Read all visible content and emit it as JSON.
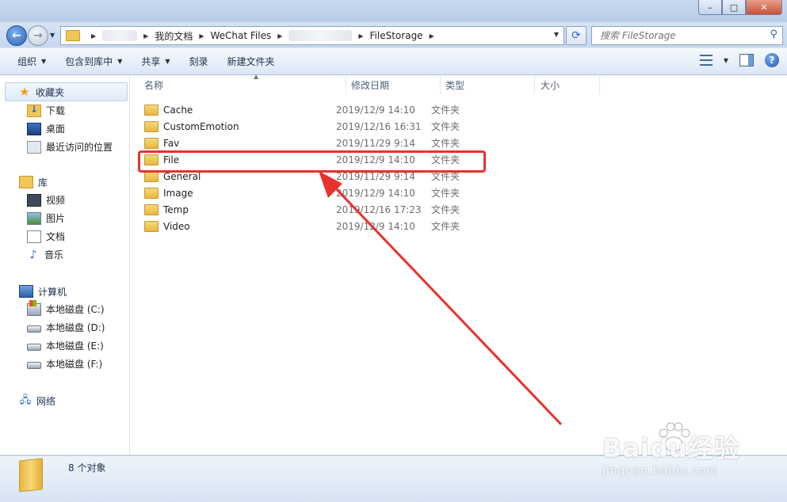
{
  "window": {
    "title_blurred": "",
    "controls": {
      "minimize": "–",
      "maximize": "□",
      "close": "✕"
    }
  },
  "address": {
    "crumbs": [
      "我的文档",
      "WeChat Files",
      "FileStorage"
    ],
    "search_placeholder": "搜索 FileStorage"
  },
  "toolbar": {
    "organize": "组织",
    "include_library": "包含到库中",
    "share": "共享",
    "burn": "刻录",
    "new_folder": "新建文件夹"
  },
  "nav": {
    "favorites": {
      "label": "收藏夹",
      "items": [
        "下载",
        "桌面",
        "最近访问的位置"
      ]
    },
    "libraries": {
      "label": "库",
      "items": [
        "视频",
        "图片",
        "文档",
        "音乐"
      ]
    },
    "computer": {
      "label": "计算机",
      "items": [
        "本地磁盘 (C:)",
        "本地磁盘 (D:)",
        "本地磁盘 (E:)",
        "本地磁盘 (F:)"
      ]
    },
    "network": {
      "label": "网络"
    }
  },
  "columns": {
    "name": "名称",
    "modified": "修改日期",
    "type": "类型",
    "size": "大小"
  },
  "files": [
    {
      "name": "Cache",
      "modified": "2019/12/9 14:10",
      "type": "文件夹"
    },
    {
      "name": "CustomEmotion",
      "modified": "2019/12/16 16:31",
      "type": "文件夹"
    },
    {
      "name": "Fav",
      "modified": "2019/11/29 9:14",
      "type": "文件夹"
    },
    {
      "name": "File",
      "modified": "2019/12/9 14:10",
      "type": "文件夹"
    },
    {
      "name": "General",
      "modified": "2019/11/29 9:14",
      "type": "文件夹"
    },
    {
      "name": "Image",
      "modified": "2019/12/9 14:10",
      "type": "文件夹"
    },
    {
      "name": "Temp",
      "modified": "2019/12/16 17:23",
      "type": "文件夹"
    },
    {
      "name": "Video",
      "modified": "2019/12/9 14:10",
      "type": "文件夹"
    }
  ],
  "status": {
    "object_count": "8 个对象"
  },
  "watermark": {
    "logo": "Baidu经验",
    "url": "jingyan.baidu.com"
  }
}
